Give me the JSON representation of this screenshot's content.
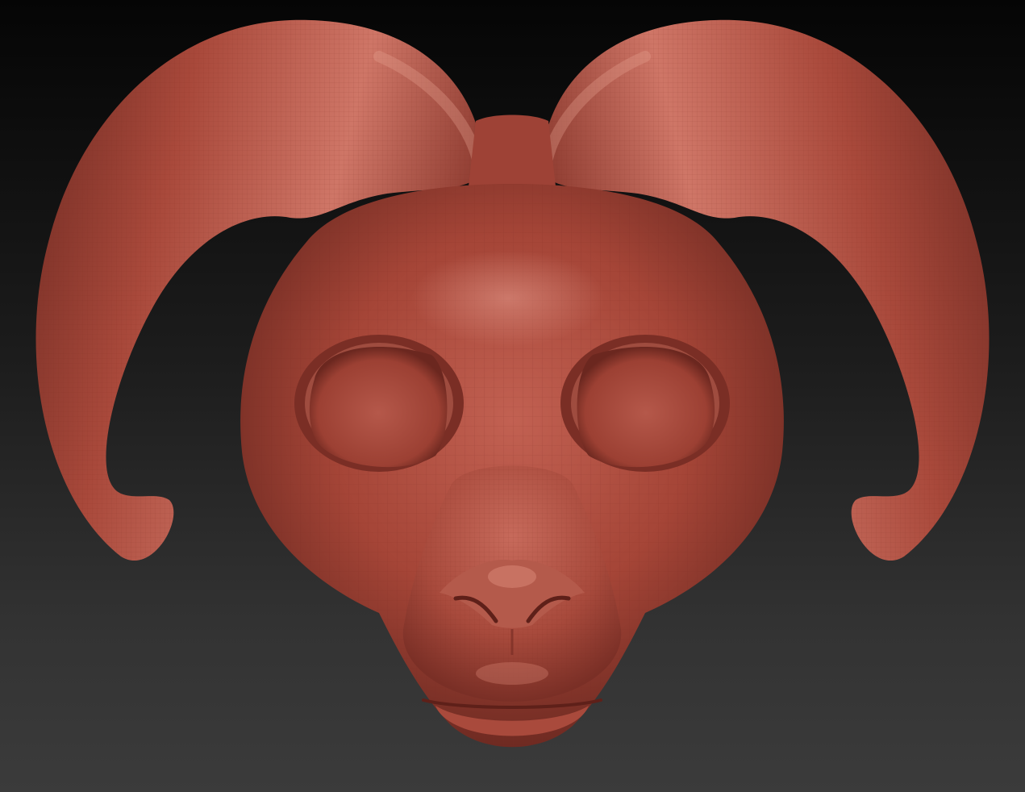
{
  "scene": {
    "subject": "ram-head-mask-sculpt",
    "background_top": "#050505",
    "background_bottom": "#3b3b3b",
    "clay_base": "#a8463a",
    "clay_shadow": "#6e2a22",
    "clay_highlight": "#d98676",
    "wire_color": "#8c3328"
  }
}
